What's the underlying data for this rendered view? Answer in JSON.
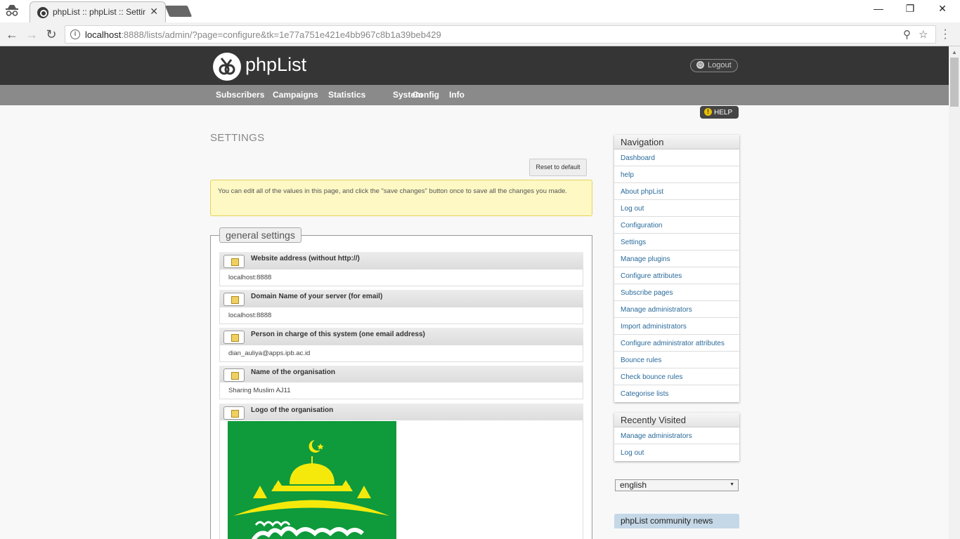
{
  "browser": {
    "tab_title": "phpList :: phpList :: Settings",
    "tab_close": "✕",
    "url_host": "localhost",
    "url_rest": ":8888/lists/admin/?page=configure&tk=1e77a751e421e4bb967c8b1a39beb429",
    "minimize": "—",
    "maximize": "❐",
    "close": "✕",
    "back": "←",
    "forward": "→",
    "reload": "↻",
    "zoom": "⚲",
    "star": "☆"
  },
  "header": {
    "logo_text": "phpList",
    "logout_label": "Logout"
  },
  "menu": {
    "items": [
      "Subscribers",
      "Campaigns",
      "Statistics",
      "System",
      "Config",
      "Info"
    ]
  },
  "help_label": "HELP",
  "page_title": "SETTINGS",
  "reset_label": "Reset to default",
  "notice": "You can edit all of the values in this page, and click the \"save changes\" button once to save all the changes you made.",
  "section_title": "general settings",
  "settings": [
    {
      "label": "Website address (without http://)",
      "value": "localhost:8888"
    },
    {
      "label": "Domain Name of your server (for email)",
      "value": "localhost:8888"
    },
    {
      "label": "Person in charge of this system (one email address)",
      "value": "dian_auliya@apps.ipb.ac.id"
    },
    {
      "label": "Name of the organisation",
      "value": "Sharing Muslim AJ11"
    },
    {
      "label": "Logo of the organisation",
      "value": ""
    }
  ],
  "navigation": {
    "title": "Navigation",
    "links": [
      "Dashboard",
      "help",
      "About phpList",
      "Log out",
      "Configuration",
      "Settings",
      "Manage plugins",
      "Configure attributes",
      "Subscribe pages",
      "Manage administrators",
      "Import administrators",
      "Configure administrator attributes",
      "Bounce rules",
      "Check bounce rules",
      "Categorise lists"
    ]
  },
  "recent": {
    "title": "Recently Visited",
    "links": [
      "Manage administrators",
      "Log out"
    ]
  },
  "language": "english",
  "community_title": "phpList community news",
  "colors": {
    "header_bg": "#353535",
    "menu_bg": "#8a8a8a",
    "logo_green": "#0f9a3c",
    "logo_yellow": "#f5e90c",
    "link": "#2a6a9a"
  }
}
